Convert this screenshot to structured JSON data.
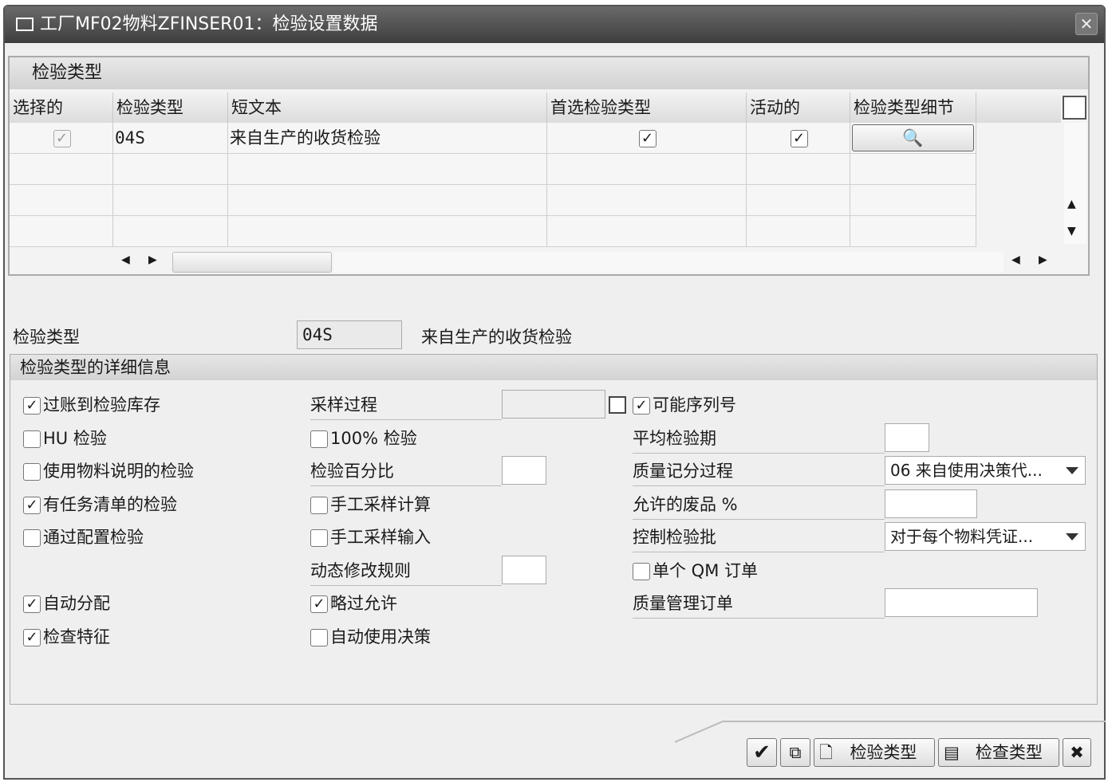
{
  "window": {
    "title": "工厂MF02物料ZFINSER01：检验设置数据",
    "close": "✕"
  },
  "table": {
    "title": "检验类型",
    "columns": [
      "选择的",
      "检验类型",
      "短文本",
      "首选检验类型",
      "活动的",
      "检验类型细节"
    ],
    "rows": [
      {
        "selected": true,
        "type": "04S",
        "text": "来自生产的收货检验",
        "preferred": true,
        "active": true
      }
    ],
    "empty_rows": 3
  },
  "field": {
    "label": "检验类型",
    "value": "04S",
    "desc": "来自生产的收货检验"
  },
  "group": {
    "title": "检验类型的详细信息",
    "col1": [
      {
        "kind": "check",
        "label": "过账到检验库存",
        "checked": true
      },
      {
        "kind": "check",
        "label": "HU 检验",
        "checked": false
      },
      {
        "kind": "check",
        "label": "使用物料说明的检验",
        "checked": false
      },
      {
        "kind": "check",
        "label": "有任务清单的检验",
        "checked": true
      },
      {
        "kind": "check",
        "label": "通过配置检验",
        "checked": false
      },
      {
        "kind": "blank"
      },
      {
        "kind": "check",
        "label": "自动分配",
        "checked": true
      },
      {
        "kind": "check",
        "label": "检查特征",
        "checked": true
      }
    ],
    "col2": [
      {
        "kind": "field",
        "label": "采样过程",
        "value": ""
      },
      {
        "kind": "check",
        "label": "100% 检验",
        "checked": false
      },
      {
        "kind": "field",
        "label": "检验百分比",
        "value": ""
      },
      {
        "kind": "check",
        "label": "手工采样计算",
        "checked": false
      },
      {
        "kind": "check",
        "label": "手工采样输入",
        "checked": false
      },
      {
        "kind": "field",
        "label": "动态修改规则",
        "value": ""
      },
      {
        "kind": "check",
        "label": "略过允许",
        "checked": true
      },
      {
        "kind": "check",
        "label": "自动使用决策",
        "checked": false
      }
    ],
    "col3": [
      {
        "kind": "check",
        "label": "可能序列号",
        "checked": true
      },
      {
        "kind": "field",
        "label": "平均检验期",
        "value": ""
      },
      {
        "kind": "select",
        "label": "质量记分过程",
        "value": "06 来自使用决策代..."
      },
      {
        "kind": "field",
        "label": "允许的废品 %",
        "value": ""
      },
      {
        "kind": "select",
        "label": "控制检验批",
        "value": "对于每个物料凭证..."
      },
      {
        "kind": "check",
        "label": "单个 QM 订单",
        "checked": false
      },
      {
        "kind": "field",
        "label": "质量管理订单",
        "value": ""
      }
    ]
  },
  "footer": {
    "btn_inspection_type": "检验类型",
    "btn_check_type": "检查类型"
  },
  "check_glyph": "✓"
}
